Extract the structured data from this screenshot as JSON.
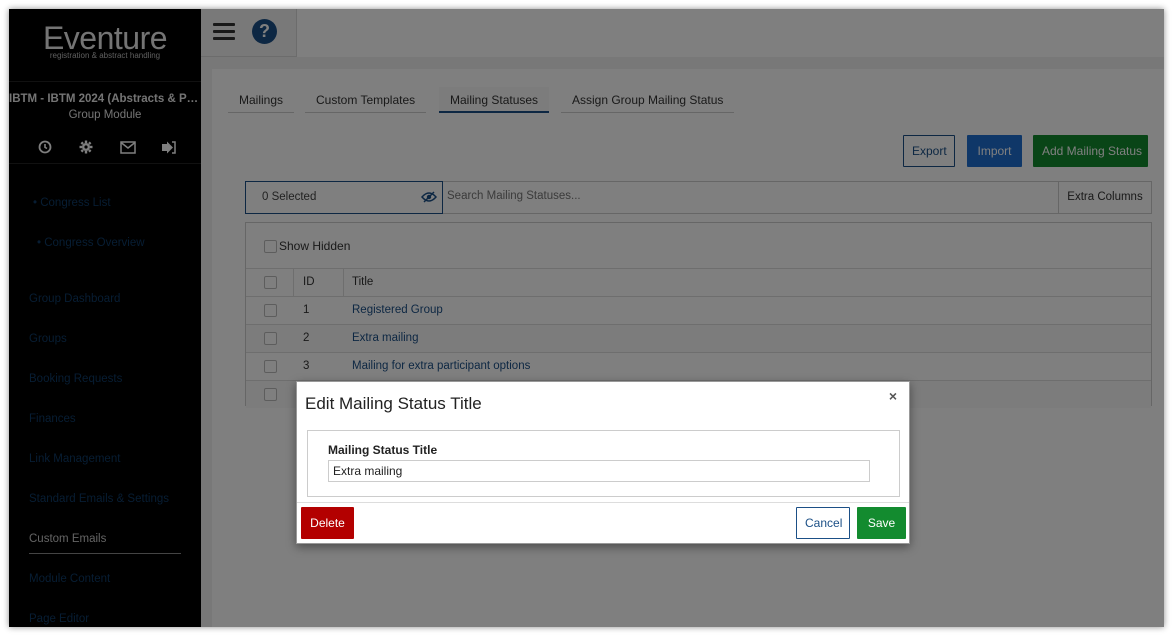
{
  "sidebar": {
    "brand": "Eventure",
    "tagline": "registration & abstract handling",
    "congress_name": "IBTM - IBTM 2024 (Abstracts & Par...",
    "module_name": "Group Module",
    "icons": [
      "clock-icon",
      "gear-icon",
      "mail-icon",
      "logout-icon"
    ],
    "nav": [
      {
        "label": "• Congress List"
      },
      {
        "label": "• Congress Overview"
      },
      {
        "label": "Group Dashboard"
      },
      {
        "label": "Groups"
      },
      {
        "label": "Booking Requests"
      },
      {
        "label": "Finances"
      },
      {
        "label": "Link Management"
      },
      {
        "label": "Standard Emails & Settings"
      },
      {
        "label": "Custom Emails"
      },
      {
        "label": "Module Content"
      },
      {
        "label": "Page Editor"
      }
    ]
  },
  "topbar": {
    "help_label": "?"
  },
  "tabs": [
    {
      "label": "Mailings"
    },
    {
      "label": "Custom Templates"
    },
    {
      "label": "Mailing Statuses"
    },
    {
      "label": "Assign Group Mailing Status"
    }
  ],
  "toolbar": {
    "export_label": "Export",
    "import_label": "Import",
    "add_label": "Add Mailing Status"
  },
  "filter": {
    "selected_text": "0 Selected",
    "search_placeholder": "Search Mailing Statuses...",
    "extra_columns_label": "Extra Columns"
  },
  "table": {
    "show_hidden_label": "Show Hidden",
    "headers": {
      "id": "ID",
      "title": "Title"
    },
    "rows": [
      {
        "id": "1",
        "title": "Registered Group"
      },
      {
        "id": "2",
        "title": "Extra mailing"
      },
      {
        "id": "3",
        "title": "Mailing for extra participant options"
      }
    ]
  },
  "modal": {
    "title": "Edit Mailing Status Title",
    "close_label": "×",
    "field_label": "Mailing Status Title",
    "field_value": "Extra mailing",
    "delete_label": "Delete",
    "cancel_label": "Cancel",
    "save_label": "Save"
  },
  "colors": {
    "primary": "#1b4f86",
    "import": "#1f6fd0",
    "success": "#138b2f",
    "danger": "#b30000",
    "sidebar_bg": "#000000"
  }
}
